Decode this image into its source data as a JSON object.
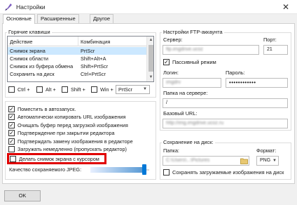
{
  "window": {
    "title": "Настройки"
  },
  "tabs": [
    {
      "label": "Основные"
    },
    {
      "label": "Расширенные"
    },
    {
      "label": "Другое"
    }
  ],
  "hotkeys": {
    "group_title": "Горячие клавиши",
    "columns": [
      "Действие",
      "Комбинация"
    ],
    "rows": [
      {
        "action": "Снимок экрана",
        "combo": "PrtScr",
        "selected": true
      },
      {
        "action": "Снимок области",
        "combo": "Shift+Alt+A",
        "selected": false
      },
      {
        "action": "Снимок из буфера обмена",
        "combo": "Shift+PrtScr",
        "selected": false
      },
      {
        "action": "Сохранить на диск",
        "combo": "Ctrl+PrtScr",
        "selected": false
      }
    ],
    "modifiers": [
      {
        "label": "Ctrl +",
        "checked": false
      },
      {
        "label": "Alt +",
        "checked": false
      },
      {
        "label": "Shift +",
        "checked": false
      },
      {
        "label": "Win +",
        "checked": false
      }
    ],
    "key_value": "PrtScr"
  },
  "options": [
    {
      "label": "Поместить в автозапуск.",
      "checked": true
    },
    {
      "label": "Автоматически копировать URL изображения",
      "checked": true
    },
    {
      "label": "Очищать буфер перед загрузкой изображения",
      "checked": true
    },
    {
      "label": "Подтверждение при закрытии редактора",
      "checked": true
    },
    {
      "label": "Подтверждать замену изображения в редакторе",
      "checked": true
    },
    {
      "label": "Загружать немедленно (пропускать редактор)",
      "checked": false
    },
    {
      "label": "Делать снимок экрана с курсором",
      "checked": false
    }
  ],
  "quality": {
    "label": "Качество сохраняемого JPEG:",
    "value_fraction": 0.95
  },
  "ftp": {
    "group_title": "Настройки FTP-аккаунта",
    "server_label": "Сервер:",
    "server_value": "ftp.imgdrive.ucoz",
    "port_label": "Порт:",
    "port_value": "21",
    "passive_label": "Пассивный режим",
    "passive_checked": true,
    "login_label": "Логин:",
    "login_value": "imgdrv",
    "password_label": "Пароль:",
    "password_value": "••••••••••••",
    "folder_label": "Папка на сервере:",
    "folder_value": "/",
    "base_url_label": "Базовый URL:",
    "base_url_value": "http://img.imgdrive.ucoz.ru"
  },
  "save_disk": {
    "group_title": "Сохранение на диск:",
    "folder_label": "Папка:",
    "folder_value": "C:\\Users\\...\\Pictures",
    "format_label": "Формат:",
    "format_value": "PNG",
    "keep_uploaded_label": "Сохранять загружаемые изображения на диск",
    "keep_uploaded_checked": false
  },
  "footer": {
    "ok_label": "OK"
  },
  "colors": {
    "accent": "#0078d7",
    "highlight": "#e00000",
    "selection": "#cce8ff"
  }
}
